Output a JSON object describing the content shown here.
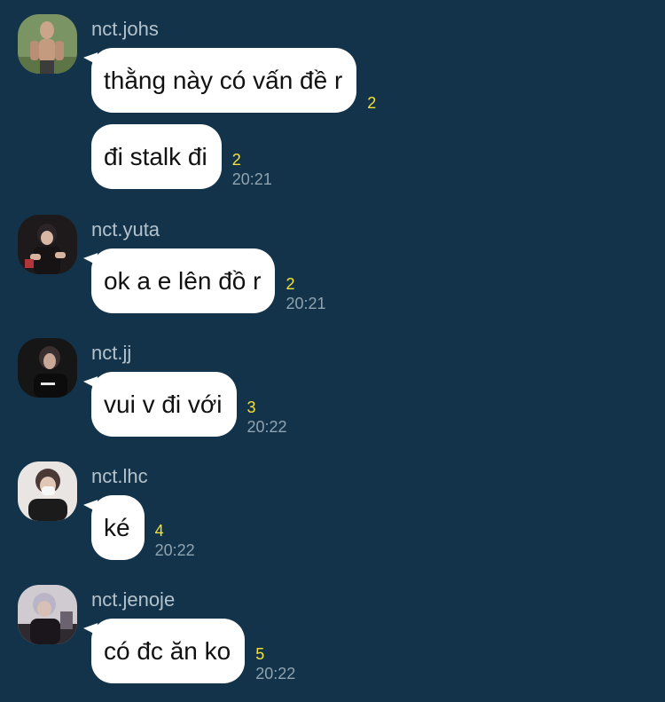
{
  "colors": {
    "background": "#123349",
    "bubble": "#ffffff",
    "unread": "#f4e13a",
    "time": "#8fa3b1",
    "name": "#b4c2cc"
  },
  "messages": [
    {
      "sender": "nct.johs",
      "avatar_icon": "user-avatar-icon",
      "items": [
        {
          "text": "thằng này có vấn đề r",
          "unread": "2",
          "time": ""
        },
        {
          "text": "đi stalk đi",
          "unread": "2",
          "time": "20:21"
        }
      ]
    },
    {
      "sender": "nct.yuta",
      "avatar_icon": "user-avatar-icon",
      "items": [
        {
          "text": "ok a e lên đồ r",
          "unread": "2",
          "time": "20:21"
        }
      ]
    },
    {
      "sender": "nct.jj",
      "avatar_icon": "user-avatar-icon",
      "items": [
        {
          "text": "vui v đi với",
          "unread": "3",
          "time": "20:22"
        }
      ]
    },
    {
      "sender": "nct.lhc",
      "avatar_icon": "user-avatar-icon",
      "items": [
        {
          "text": "ké",
          "unread": "4",
          "time": "20:22"
        }
      ]
    },
    {
      "sender": "nct.jenoje",
      "avatar_icon": "user-avatar-icon",
      "items": [
        {
          "text": "có đc ăn ko",
          "unread": "5",
          "time": "20:22"
        }
      ]
    }
  ]
}
